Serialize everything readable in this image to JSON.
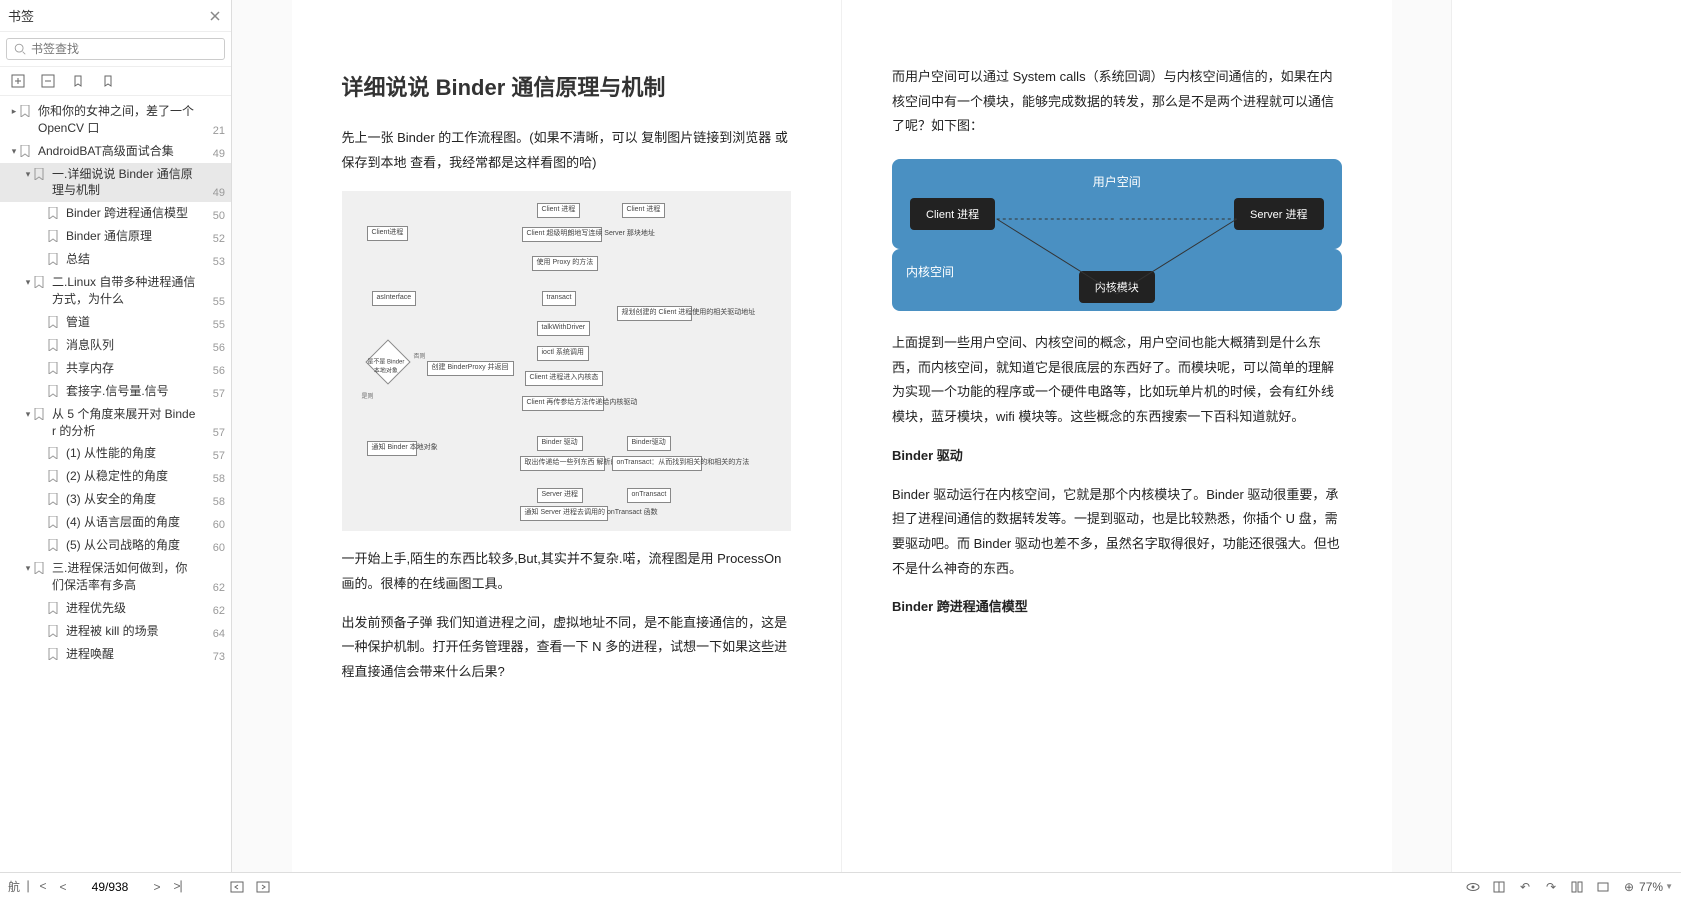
{
  "sidebar": {
    "title": "书签",
    "search_placeholder": "书签查找",
    "tree": [
      {
        "indent": 0,
        "arrow": "▸",
        "icon": "🔖",
        "label": "你和你的女神之间，差了一个 OpenCV 口",
        "page": "21",
        "selected": false
      },
      {
        "indent": 0,
        "arrow": "▾",
        "icon": "🔖",
        "label": "AndroidBAT高级面试合集",
        "page": "49",
        "selected": false
      },
      {
        "indent": 1,
        "arrow": "▾",
        "icon": "🔖",
        "label": "一.详细说说 Binder 通信原理与机制",
        "page": "49",
        "selected": true
      },
      {
        "indent": 2,
        "arrow": "",
        "icon": "🔖",
        "label": "Binder 跨进程通信模型",
        "page": "50",
        "selected": false
      },
      {
        "indent": 2,
        "arrow": "",
        "icon": "🔖",
        "label": "Binder 通信原理",
        "page": "52",
        "selected": false
      },
      {
        "indent": 2,
        "arrow": "",
        "icon": "🔖",
        "label": "总结",
        "page": "53",
        "selected": false
      },
      {
        "indent": 1,
        "arrow": "▾",
        "icon": "🔖",
        "label": "二.Linux 自带多种进程通信方式，为什么",
        "page": "55",
        "selected": false
      },
      {
        "indent": 2,
        "arrow": "",
        "icon": "🔖",
        "label": "管道",
        "page": "55",
        "selected": false
      },
      {
        "indent": 2,
        "arrow": "",
        "icon": "🔖",
        "label": "消息队列",
        "page": "56",
        "selected": false
      },
      {
        "indent": 2,
        "arrow": "",
        "icon": "🔖",
        "label": "共享内存",
        "page": "56",
        "selected": false
      },
      {
        "indent": 2,
        "arrow": "",
        "icon": "🔖",
        "label": "套接字.信号量.信号",
        "page": "57",
        "selected": false
      },
      {
        "indent": 1,
        "arrow": "▾",
        "icon": "🔖",
        "label": "从 5 个角度来展开对 Binder 的分析",
        "page": "57",
        "selected": false
      },
      {
        "indent": 2,
        "arrow": "",
        "icon": "🔖",
        "label": "(1) 从性能的角度",
        "page": "57",
        "selected": false
      },
      {
        "indent": 2,
        "arrow": "",
        "icon": "🔖",
        "label": "(2) 从稳定性的角度",
        "page": "58",
        "selected": false
      },
      {
        "indent": 2,
        "arrow": "",
        "icon": "🔖",
        "label": "(3) 从安全的角度",
        "page": "58",
        "selected": false
      },
      {
        "indent": 2,
        "arrow": "",
        "icon": "🔖",
        "label": "(4) 从语言层面的角度",
        "page": "60",
        "selected": false
      },
      {
        "indent": 2,
        "arrow": "",
        "icon": "🔖",
        "label": "(5) 从公司战略的角度",
        "page": "60",
        "selected": false
      },
      {
        "indent": 1,
        "arrow": "▾",
        "icon": "🔖",
        "label": "三.进程保活如何做到，你们保活率有多高",
        "page": "62",
        "selected": false
      },
      {
        "indent": 2,
        "arrow": "",
        "icon": "🔖",
        "label": "进程优先级",
        "page": "62",
        "selected": false
      },
      {
        "indent": 2,
        "arrow": "",
        "icon": "🔖",
        "label": "进程被 kill 的场景",
        "page": "64",
        "selected": false
      },
      {
        "indent": 2,
        "arrow": "",
        "icon": "🔖",
        "label": "进程唤醒",
        "page": "73",
        "selected": false
      }
    ]
  },
  "doc": {
    "left": {
      "title": "详细说说 Binder 通信原理与机制",
      "p1": "先上一张 Binder 的工作流程图。(如果不清晰，可以 复制图片链接到浏览器 或保存到本地 查看，我经常都是这样看图的哈)",
      "flowchart": {
        "b1": "Client进程",
        "b2": "Client 进程",
        "b3": "Client 进程",
        "b4": "Client 超级明朗地写连续 Server 那块地址",
        "b5": "使用 Proxy 的方法",
        "b6": "asInterface",
        "b7": "transact",
        "b8": "talkWithDriver",
        "b9": "ioctl 系统调用",
        "b10": "Client 进程进入内核态",
        "b11": "Client 再传参给方法传递给内核驱动",
        "b12": "Binder 驱动",
        "b13": "Binder驱动",
        "b14": "规划创建的 Client 进程使用的相关驱动地址",
        "b15": "通知 Binder 本地对象",
        "b16": "创建 BinderProxy 并返回",
        "b17": "取出传递给一些列东西 解析的 Server IBinder",
        "b18": "onTransact：从而找到相关的和相关的方法",
        "b19": "Server 进程",
        "b20": "通知 Server 进程去调用的 onTransact 函数",
        "b21": "onTransact",
        "diamond": "是不是 Binder本地对象",
        "yes": "是则",
        "no": "否则"
      },
      "p2": "一开始上手,陌生的东西比较多,But,其实并不复杂.喏，流程图是用 ProcessOn 画的。很棒的在线画图工具。",
      "p3": "出发前预备子弹 我们知道进程之间，虚拟地址不同，是不能直接通信的，这是一种保护机制。打开任务管理器，查看一下 N 多的进程，试想一下如果这些进程直接通信会带来什么后果?"
    },
    "right": {
      "p1": "而用户空间可以通过 System calls（系统回调）与内核空间通信的，如果在内核空间中有一个模块，能够完成数据的转发，那么是不是两个进程就可以通信了呢？如下图：",
      "diagram": {
        "user_title": "用户空间",
        "client": "Client 进程",
        "server": "Server 进程",
        "kernel_title": "内核空间",
        "module": "内核模块"
      },
      "p2": "上面提到一些用户空间、内核空间的概念，用户空间也能大概猜到是什么东西，而内核空间，就知道它是很底层的东西好了。而模块呢，可以简单的理解为实现一个功能的程序或一个硬件电路等，比如玩单片机的时候，会有红外线模块，蓝牙模块，wifi 模块等。这些概念的东西搜索一下百科知道就好。",
      "h1": "Binder 驱动",
      "p3": "Binder 驱动运行在内核空间，它就是那个内核模块了。Binder 驱动很重要，承担了进程间通信的数据转发等。一提到驱动，也是比较熟悉，你插个 U 盘，需要驱动吧。而 Binder 驱动也差不多，虽然名字取得很好，功能还很强大。但也不是什么神奇的东西。",
      "h2": "Binder 跨进程通信模型"
    }
  },
  "status": {
    "page": "49/938",
    "zoom": "77%"
  }
}
